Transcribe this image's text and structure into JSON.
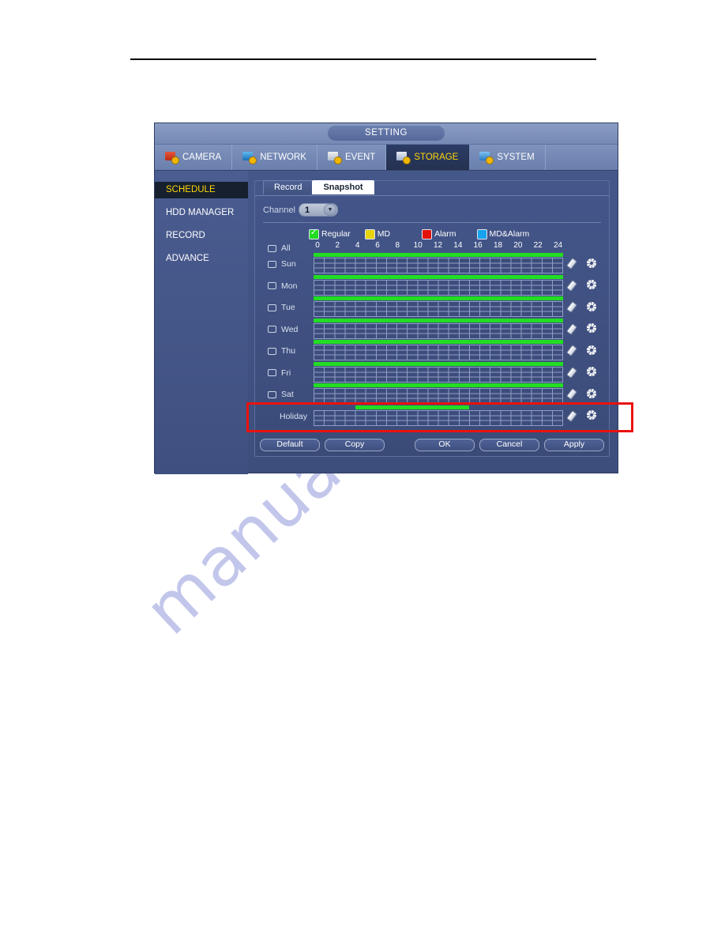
{
  "document": {
    "watermark": "manualslib"
  },
  "dialog": {
    "title": "SETTING",
    "topnav": [
      {
        "label": "CAMERA",
        "icon": "camera-icon",
        "active": false
      },
      {
        "label": "NETWORK",
        "icon": "network-icon",
        "active": false
      },
      {
        "label": "EVENT",
        "icon": "event-icon",
        "active": false
      },
      {
        "label": "STORAGE",
        "icon": "storage-icon",
        "active": true
      },
      {
        "label": "SYSTEM",
        "icon": "system-icon",
        "active": false
      }
    ],
    "sidebar": [
      {
        "label": "SCHEDULE",
        "active": true
      },
      {
        "label": "HDD MANAGER",
        "active": false
      },
      {
        "label": "RECORD",
        "active": false
      },
      {
        "label": "ADVANCE",
        "active": false
      }
    ],
    "subtabs": [
      {
        "label": "Record",
        "active": false
      },
      {
        "label": "Snapshot",
        "active": true
      }
    ],
    "channel": {
      "label": "Channel",
      "value": "1",
      "options": [
        "1"
      ]
    },
    "legend": [
      {
        "label": "Regular",
        "color": "#22dd22",
        "checked": true
      },
      {
        "label": "MD",
        "color": "#e8d40a",
        "checked": false
      },
      {
        "label": "Alarm",
        "color": "#e3110c",
        "checked": false
      },
      {
        "label": "MD&Alarm",
        "color": "#17a3ee",
        "checked": false
      }
    ],
    "hour_ticks": [
      "0",
      "2",
      "4",
      "6",
      "8",
      "10",
      "12",
      "14",
      "16",
      "18",
      "20",
      "22",
      "24"
    ],
    "all_row_label": "All",
    "schedule_rows": [
      {
        "label": "Sun",
        "checkbox": true,
        "periods": [
          {
            "start": 0,
            "end": 24
          }
        ]
      },
      {
        "label": "Mon",
        "checkbox": true,
        "periods": [
          {
            "start": 0,
            "end": 24
          }
        ]
      },
      {
        "label": "Tue",
        "checkbox": true,
        "periods": [
          {
            "start": 0,
            "end": 24
          }
        ]
      },
      {
        "label": "Wed",
        "checkbox": true,
        "periods": [
          {
            "start": 0,
            "end": 24
          }
        ]
      },
      {
        "label": "Thu",
        "checkbox": true,
        "periods": [
          {
            "start": 0,
            "end": 24
          }
        ]
      },
      {
        "label": "Fri",
        "checkbox": true,
        "periods": [
          {
            "start": 0,
            "end": 24
          }
        ]
      },
      {
        "label": "Sat",
        "checkbox": true,
        "periods": [
          {
            "start": 0,
            "end": 24
          }
        ]
      },
      {
        "label": "Holiday",
        "checkbox": false,
        "periods": [
          {
            "start": 4,
            "end": 15
          }
        ]
      }
    ],
    "row_tools": {
      "eraser": "eraser-icon",
      "settings": "gear-icon"
    },
    "buttons_left": [
      "Default",
      "Copy"
    ],
    "buttons_right": [
      "OK",
      "Cancel",
      "Apply"
    ]
  },
  "annotation": {
    "color": "#e8120e",
    "target": "holiday-row"
  }
}
